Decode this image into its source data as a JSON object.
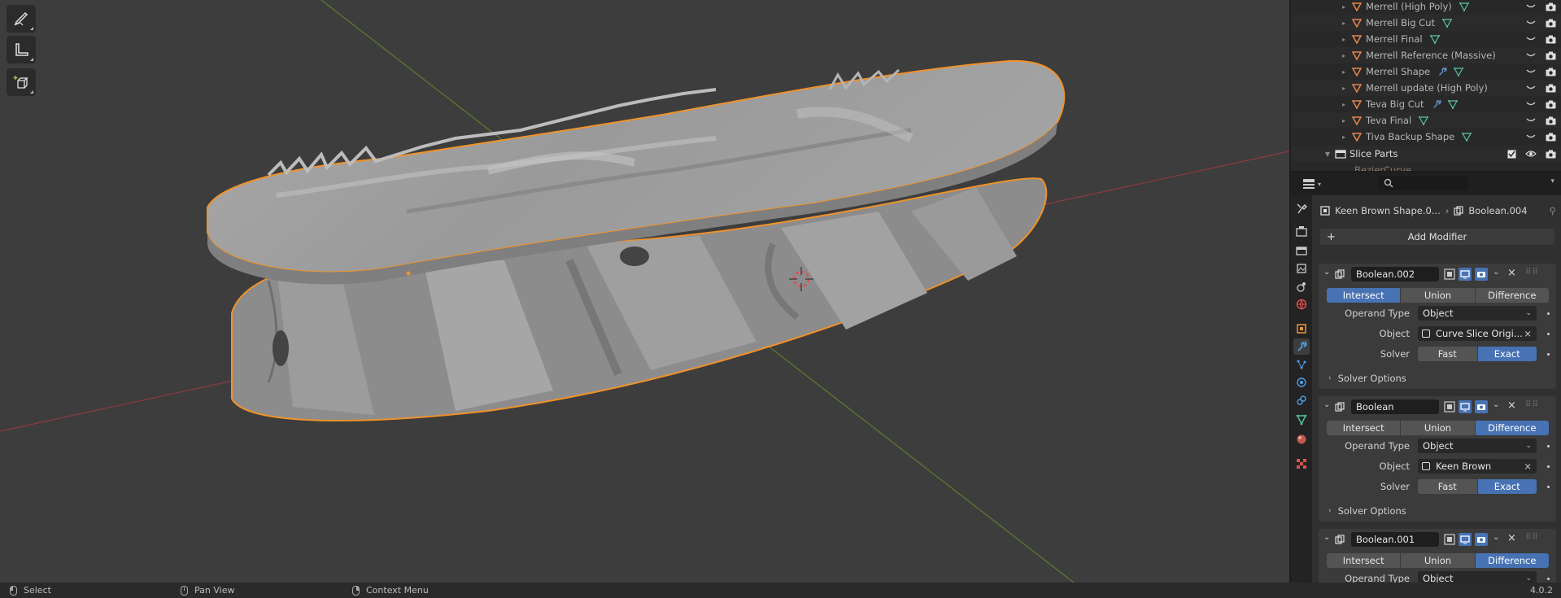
{
  "viewport": {
    "tools": [
      "annotate-icon",
      "measure-icon",
      "add-cube-icon"
    ]
  },
  "outliner": {
    "items": [
      {
        "name": "Merrell (High Poly)",
        "icons": [
          "mesh"
        ]
      },
      {
        "name": "Merrell Big Cut",
        "icons": [
          "mesh"
        ]
      },
      {
        "name": "Merrell Final",
        "icons": [
          "mesh"
        ]
      },
      {
        "name": "Merrell Reference (Massive)",
        "icons": []
      },
      {
        "name": "Merrell Shape",
        "icons": [
          "wrench",
          "mesh"
        ]
      },
      {
        "name": "Merrell update (High Poly)",
        "icons": []
      },
      {
        "name": "Teva Big Cut",
        "icons": [
          "wrench",
          "mesh"
        ]
      },
      {
        "name": "Teva Final",
        "icons": [
          "mesh"
        ]
      },
      {
        "name": "Tiva Backup Shape",
        "icons": [
          "mesh"
        ]
      }
    ],
    "collection": "Slice Parts",
    "partial_item": "BezierCurve"
  },
  "properties": {
    "breadcrumb_object": "Keen Brown Shape.0...",
    "breadcrumb_modifier": "Boolean.004",
    "add_modifier": "Add Modifier",
    "labels": {
      "operand_type": "Operand Type",
      "object": "Object",
      "solver": "Solver",
      "solver_options": "Solver Options"
    },
    "operations": [
      "Intersect",
      "Union",
      "Difference"
    ],
    "solvers": [
      "Fast",
      "Exact"
    ],
    "modifiers": [
      {
        "name": "Boolean.002",
        "operation": "Intersect",
        "operand_type": "Object",
        "object": "Curve Slice Origi...",
        "solver": "Exact"
      },
      {
        "name": "Boolean",
        "operation": "Difference",
        "operand_type": "Object",
        "object": "Keen Brown",
        "solver": "Exact"
      },
      {
        "name": "Boolean.001",
        "operation": "Difference",
        "operand_type": "Object"
      }
    ]
  },
  "status": {
    "select": "Select",
    "pan": "Pan View",
    "context": "Context Menu",
    "version": "4.0.2"
  },
  "colors": {
    "selection_outline": "#f0922a",
    "x_axis": "#8f3a3f",
    "y_axis": "#5e7e2a",
    "active_blue": "#4772b3"
  }
}
